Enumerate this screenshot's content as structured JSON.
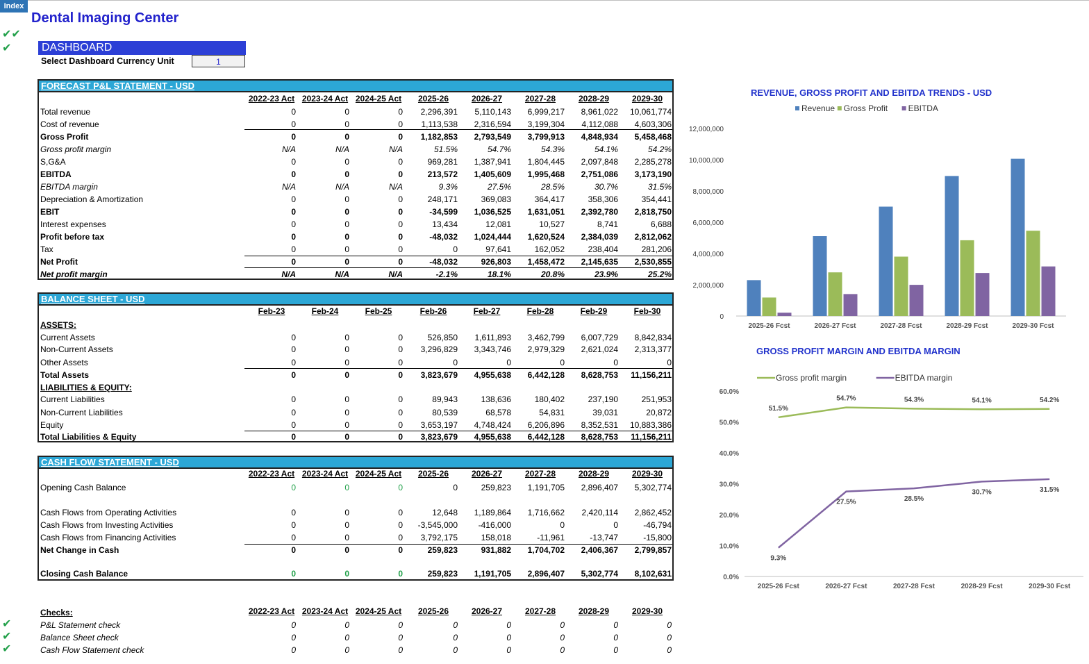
{
  "index_tab": "Index",
  "company": "Dental Imaging Center",
  "dashboard": {
    "title": "DASHBOARD",
    "currency_label": "Select Dashboard Currency Unit",
    "currency_value": "1"
  },
  "pl": {
    "title": "FORECAST P&L STATEMENT - USD",
    "columns": [
      "2022-23 Act",
      "2023-24 Act",
      "2024-25 Act",
      "2025-26",
      "2026-27",
      "2027-28",
      "2028-29",
      "2029-30"
    ],
    "rows": [
      {
        "label": "Total revenue",
        "style": "",
        "values": [
          "0",
          "0",
          "0",
          "2,296,391",
          "5,110,143",
          "6,999,217",
          "8,961,022",
          "10,061,774"
        ]
      },
      {
        "label": "Cost of revenue",
        "style": "",
        "values": [
          "0",
          "0",
          "0",
          "1,113,538",
          "2,316,594",
          "3,199,304",
          "4,112,088",
          "4,603,306"
        ]
      },
      {
        "label": "Gross Profit",
        "style": "bold",
        "values": [
          "0",
          "0",
          "0",
          "1,182,853",
          "2,793,549",
          "3,799,913",
          "4,848,934",
          "5,458,468"
        ]
      },
      {
        "label": "Gross profit margin",
        "style": "ital",
        "values": [
          "N/A",
          "N/A",
          "N/A",
          "51.5%",
          "54.7%",
          "54.3%",
          "54.1%",
          "54.2%"
        ]
      },
      {
        "label": "S,G&A",
        "style": "",
        "values": [
          "0",
          "0",
          "0",
          "969,281",
          "1,387,941",
          "1,804,445",
          "2,097,848",
          "2,285,278"
        ]
      },
      {
        "label": "EBITDA",
        "style": "bold",
        "values": [
          "0",
          "0",
          "0",
          "213,572",
          "1,405,609",
          "1,995,468",
          "2,751,086",
          "3,173,190"
        ]
      },
      {
        "label": "EBITDA margin",
        "style": "ital",
        "values": [
          "N/A",
          "N/A",
          "N/A",
          "9.3%",
          "27.5%",
          "28.5%",
          "30.7%",
          "31.5%"
        ]
      },
      {
        "label": "Depreciation & Amortization",
        "style": "",
        "values": [
          "0",
          "0",
          "0",
          "248,171",
          "369,083",
          "364,417",
          "358,306",
          "354,441"
        ]
      },
      {
        "label": "EBIT",
        "style": "bold",
        "values": [
          "0",
          "0",
          "0",
          "-34,599",
          "1,036,525",
          "1,631,051",
          "2,392,780",
          "2,818,750"
        ]
      },
      {
        "label": "Interest expenses",
        "style": "",
        "values": [
          "0",
          "0",
          "0",
          "13,434",
          "12,081",
          "10,527",
          "8,741",
          "6,688"
        ]
      },
      {
        "label": "Profit before tax",
        "style": "bold",
        "values": [
          "0",
          "0",
          "0",
          "-48,032",
          "1,024,444",
          "1,620,524",
          "2,384,039",
          "2,812,062"
        ]
      },
      {
        "label": "Tax",
        "style": "",
        "values": [
          "0",
          "0",
          "0",
          "0",
          "97,641",
          "162,052",
          "238,404",
          "281,206"
        ]
      },
      {
        "label": "Net Profit",
        "style": "bold",
        "values": [
          "0",
          "0",
          "0",
          "-48,032",
          "926,803",
          "1,458,472",
          "2,145,635",
          "2,530,855"
        ]
      },
      {
        "label": "Net profit margin",
        "style": "bold ital",
        "values": [
          "N/A",
          "N/A",
          "N/A",
          "-2.1%",
          "18.1%",
          "20.8%",
          "23.9%",
          "25.2%"
        ]
      }
    ]
  },
  "bs": {
    "title": "BALANCE SHEET - USD",
    "columns": [
      "Feb-23",
      "Feb-24",
      "Feb-25",
      "Feb-26",
      "Feb-27",
      "Feb-28",
      "Feb-29",
      "Feb-30"
    ],
    "rows": [
      {
        "label": "ASSETS:",
        "style": "uline",
        "values": [
          "",
          "",
          "",
          "",
          "",
          "",
          "",
          ""
        ]
      },
      {
        "label": "Current Assets",
        "style": "",
        "values": [
          "0",
          "0",
          "0",
          "526,850",
          "1,611,893",
          "3,462,799",
          "6,007,729",
          "8,842,834"
        ]
      },
      {
        "label": "Non-Current Assets",
        "style": "",
        "values": [
          "0",
          "0",
          "0",
          "3,296,829",
          "3,343,746",
          "2,979,329",
          "2,621,024",
          "2,313,377"
        ]
      },
      {
        "label": "Other Assets",
        "style": "",
        "values": [
          "0",
          "0",
          "0",
          "0",
          "0",
          "0",
          "0",
          "0"
        ]
      },
      {
        "label": "Total Assets",
        "style": "bold",
        "values": [
          "0",
          "0",
          "0",
          "3,823,679",
          "4,955,638",
          "6,442,128",
          "8,628,753",
          "11,156,211"
        ]
      },
      {
        "label": "LIABILITIES & EQUITY:",
        "style": "uline",
        "values": [
          "",
          "",
          "",
          "",
          "",
          "",
          "",
          ""
        ]
      },
      {
        "label": "Current Liabilities",
        "style": "",
        "values": [
          "0",
          "0",
          "0",
          "89,943",
          "138,636",
          "180,402",
          "237,190",
          "251,953"
        ]
      },
      {
        "label": "Non-Current Liabilities",
        "style": "",
        "values": [
          "0",
          "0",
          "0",
          "80,539",
          "68,578",
          "54,831",
          "39,031",
          "20,872"
        ]
      },
      {
        "label": "Equity",
        "style": "",
        "values": [
          "0",
          "0",
          "0",
          "3,653,197",
          "4,748,424",
          "6,206,896",
          "8,352,531",
          "10,883,386"
        ]
      },
      {
        "label": "Total Liabilities & Equity",
        "style": "bold",
        "values": [
          "0",
          "0",
          "0",
          "3,823,679",
          "4,955,638",
          "6,442,128",
          "8,628,753",
          "11,156,211"
        ]
      }
    ]
  },
  "cf": {
    "title": "CASH FLOW STATEMENT -  USD",
    "columns": [
      "2022-23 Act",
      "2023-24 Act",
      "2024-25 Act",
      "2025-26",
      "2026-27",
      "2027-28",
      "2028-29",
      "2029-30"
    ],
    "rows": [
      {
        "label": "Opening Cash Balance",
        "style": "",
        "values": [
          "0",
          "0",
          "0",
          "0",
          "259,823",
          "1,191,705",
          "2,896,407",
          "5,302,774"
        ]
      },
      {
        "label": "Cash Flows from Operating Activities",
        "style": "",
        "values": [
          "0",
          "0",
          "0",
          "12,648",
          "1,189,864",
          "1,716,662",
          "2,420,114",
          "2,862,452"
        ]
      },
      {
        "label": "Cash Flows from Investing Activities",
        "style": "",
        "values": [
          "0",
          "0",
          "0",
          "-3,545,000",
          "-416,000",
          "0",
          "0",
          "-46,794"
        ]
      },
      {
        "label": "Cash Flows from Financing Activities",
        "style": "",
        "values": [
          "0",
          "0",
          "0",
          "3,792,175",
          "158,018",
          "-11,961",
          "-13,747",
          "-15,800"
        ]
      },
      {
        "label": "Net Change in Cash",
        "style": "bold",
        "values": [
          "0",
          "0",
          "0",
          "259,823",
          "931,882",
          "1,704,702",
          "2,406,367",
          "2,799,857"
        ]
      },
      {
        "label": "Closing Cash Balance",
        "style": "bold",
        "values": [
          "0",
          "0",
          "0",
          "259,823",
          "1,191,705",
          "2,896,407",
          "5,302,774",
          "8,102,631"
        ]
      }
    ]
  },
  "checks": {
    "title": "Checks:",
    "columns": [
      "2022-23 Act",
      "2023-24 Act",
      "2024-25 Act",
      "2025-26",
      "2026-27",
      "2027-28",
      "2028-29",
      "2029-30"
    ],
    "rows": [
      {
        "label": "P&L Statement check",
        "style": "ital",
        "values": [
          "0",
          "0",
          "0",
          "0",
          "0",
          "0",
          "0",
          "0"
        ]
      },
      {
        "label": "Balance Sheet check",
        "style": "ital",
        "values": [
          "0",
          "0",
          "0",
          "0",
          "0",
          "0",
          "0",
          "0"
        ]
      },
      {
        "label": "Cash Flow Statement check",
        "style": "ital",
        "values": [
          "0",
          "0",
          "0",
          "0",
          "0",
          "0",
          "0",
          "0"
        ]
      }
    ]
  },
  "colors": {
    "revenue": "#4f81bd",
    "gross_profit": "#9bbb59",
    "ebitda": "#8064a2",
    "accent": "#2c3fd6",
    "header": "#2ca7d6",
    "check": "#22a04a"
  },
  "chart_data": [
    {
      "type": "bar",
      "title": "REVENUE, GROSS PROFIT AND EBITDA TRENDS - USD",
      "categories": [
        "2025-26 Fcst",
        "2026-27 Fcst",
        "2027-28 Fcst",
        "2028-29 Fcst",
        "2029-30 Fcst"
      ],
      "series": [
        {
          "name": "Revenue",
          "values": [
            2296391,
            5110143,
            6999217,
            8961022,
            10061774
          ]
        },
        {
          "name": "Gross Profit",
          "values": [
            1182853,
            2793549,
            3799913,
            4848934,
            5458468
          ]
        },
        {
          "name": "EBITDA",
          "values": [
            213572,
            1405609,
            1995468,
            2751086,
            3173190
          ]
        }
      ],
      "yticks": [
        "0",
        "2,000,000",
        "4,000,000",
        "6,000,000",
        "8,000,000",
        "10,000,000",
        "12,000,000"
      ],
      "ylim": [
        0,
        12000000
      ],
      "legend": "top"
    },
    {
      "type": "line",
      "title": "GROSS PROFIT MARGIN AND EBITDA MARGIN",
      "categories": [
        "2025-26 Fcst",
        "2026-27 Fcst",
        "2027-28 Fcst",
        "2028-29 Fcst",
        "2029-30 Fcst"
      ],
      "series": [
        {
          "name": "Gross profit margin",
          "values": [
            51.5,
            54.7,
            54.3,
            54.1,
            54.2
          ],
          "labels": [
            "51.5%",
            "54.7%",
            "54.3%",
            "54.1%",
            "54.2%"
          ]
        },
        {
          "name": "EBITDA margin",
          "values": [
            9.3,
            27.5,
            28.5,
            30.7,
            31.5
          ],
          "labels": [
            "9.3%",
            "27.5%",
            "28.5%",
            "30.7%",
            "31.5%"
          ]
        }
      ],
      "yticks": [
        "0.0%",
        "10.0%",
        "20.0%",
        "30.0%",
        "40.0%",
        "50.0%",
        "60.0%"
      ],
      "ylim": [
        0,
        60
      ],
      "legend": "top"
    }
  ]
}
